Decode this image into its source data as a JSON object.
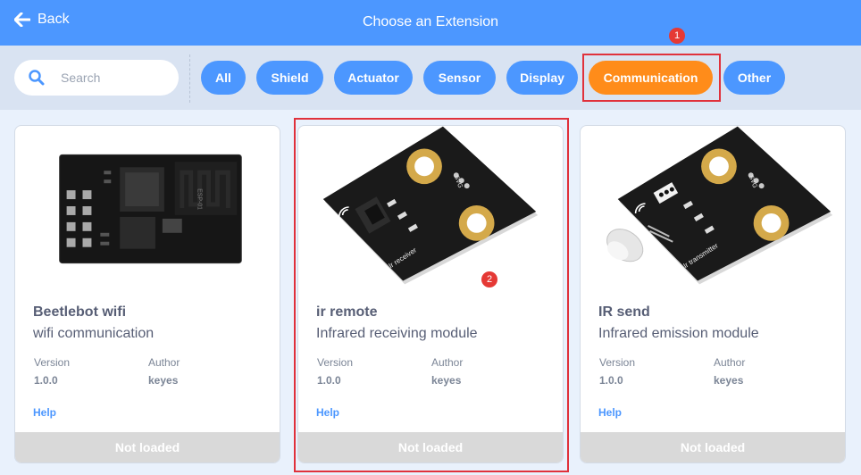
{
  "header": {
    "back_label": "Back",
    "title": "Choose an Extension"
  },
  "search": {
    "placeholder": "Search"
  },
  "tags": [
    {
      "label": "All"
    },
    {
      "label": "Shield"
    },
    {
      "label": "Actuator"
    },
    {
      "label": "Sensor"
    },
    {
      "label": "Display"
    },
    {
      "label": "Communication",
      "active": true
    },
    {
      "label": "Other"
    }
  ],
  "badges": [
    "1",
    "2"
  ],
  "extensions": [
    {
      "name": "Beetlebot wifi",
      "description": "wifi communication",
      "version_label": "Version",
      "version": "1.0.0",
      "author_label": "Author",
      "author": "keyes",
      "help_label": "Help",
      "status": "Not loaded",
      "image_text": "ESP-01"
    },
    {
      "name": "ir remote",
      "description": "Infrared receiving module",
      "version_label": "Version",
      "version": "1.0.0",
      "author_label": "Author",
      "author": "keyes",
      "help_label": "Help",
      "status": "Not loaded",
      "image_text": "Ir receiver",
      "pins": "SVG"
    },
    {
      "name": "IR send",
      "description": "Infrared emission module",
      "version_label": "Version",
      "version": "1.0.0",
      "author_label": "Author",
      "author": "keyes",
      "help_label": "Help",
      "status": "Not loaded",
      "image_text": "Ir transmitter",
      "pins": "SVG"
    }
  ],
  "colors": {
    "primary": "#4c97ff",
    "active": "#ff8c1a",
    "highlight": "#e0313b",
    "text": "#575e75"
  }
}
